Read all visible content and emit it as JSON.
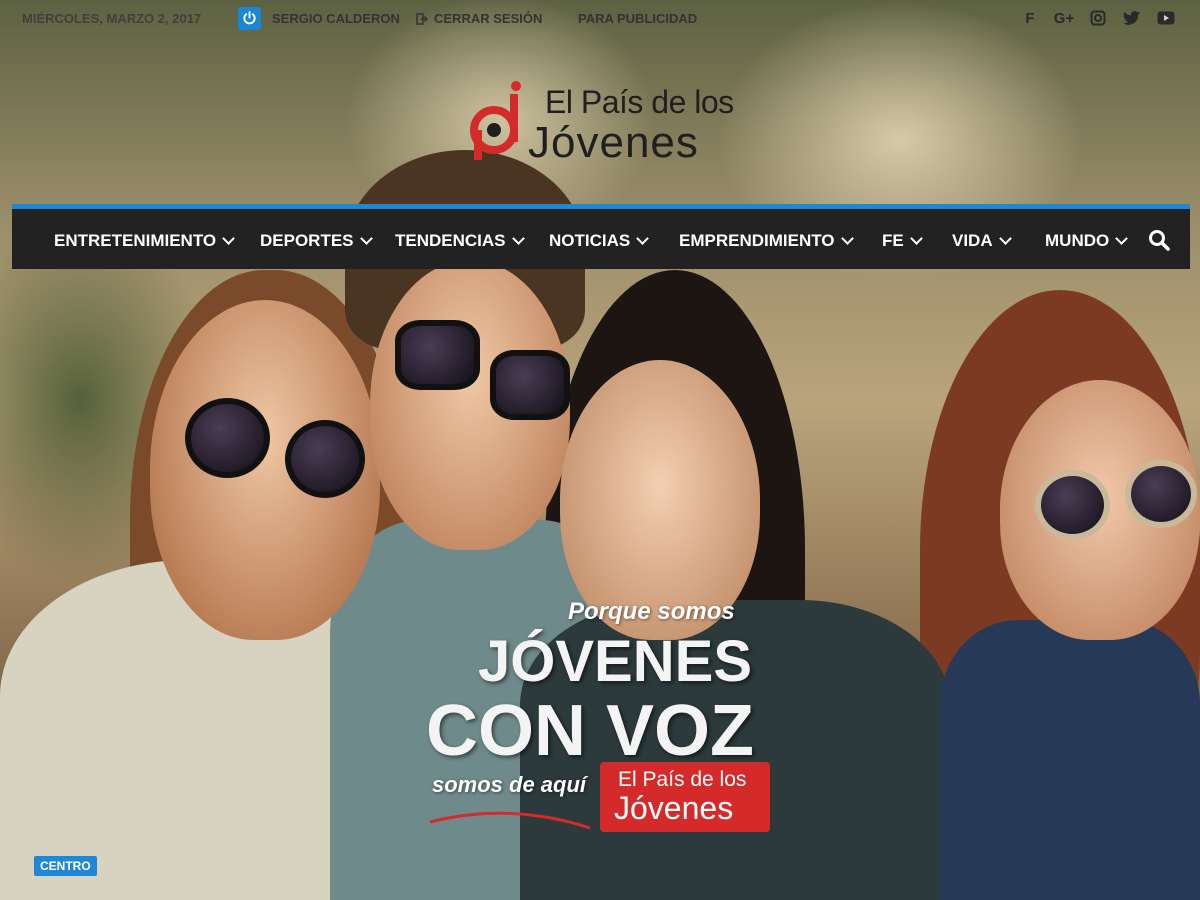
{
  "topbar": {
    "date": "MIÉRCOLES, MARZO 2, 2017",
    "user": "SERGIO CALDERON",
    "logout": "CERRAR SESIÓN",
    "ads": "PARA PUBLICIDAD"
  },
  "social": [
    "facebook-icon",
    "google-plus-icon",
    "instagram-icon",
    "twitter-icon",
    "youtube-icon"
  ],
  "logo": {
    "line1": "El País de los",
    "line2": "Jóvenes"
  },
  "nav": {
    "items": [
      {
        "label": "ENTRETENIMIENTO"
      },
      {
        "label": "DEPORTES"
      },
      {
        "label": "TENDENCIAS"
      },
      {
        "label": "NOTICIAS"
      },
      {
        "label": "EMPRENDIMIENTO"
      },
      {
        "label": "FE"
      },
      {
        "label": "VIDA"
      },
      {
        "label": "MUNDO"
      }
    ]
  },
  "ad": {
    "pre": "Porque somos",
    "big1": "JÓVENES",
    "big2": "CON VOZ",
    "sub": "somos de aquí",
    "badge_line1": "El País de los",
    "badge_line2": "Jóvenes"
  },
  "category_tag": "CENTRO",
  "colors": {
    "accent": "#1e88d6",
    "nav_bg": "#222222",
    "brand_red": "#d42a2a"
  }
}
